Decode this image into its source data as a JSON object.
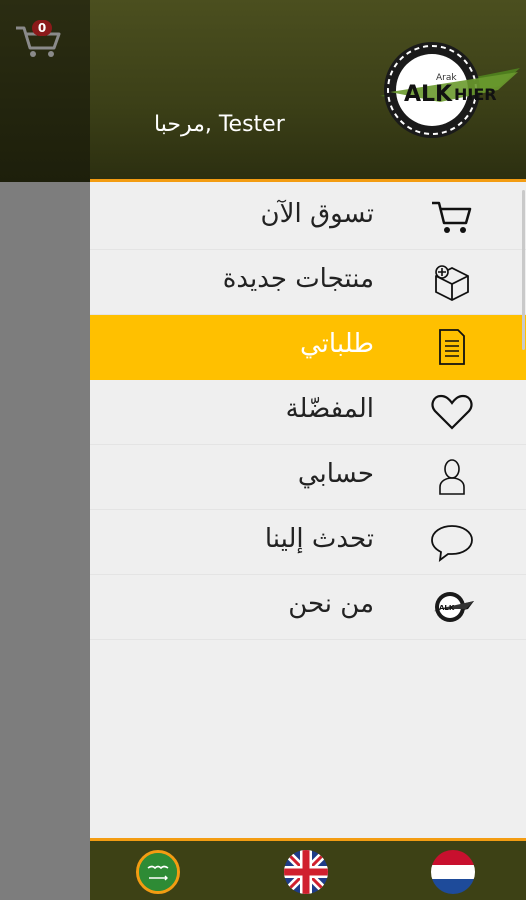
{
  "background": {
    "cart_count": "0",
    "accent_color": "#8b1a1a"
  },
  "drawer": {
    "welcome_text": "مرحبا, Tester",
    "logo_text": "ALKHIER",
    "logo_subtext": "Arak",
    "menu": [
      {
        "label": "تسوق الآن",
        "icon": "cart-icon"
      },
      {
        "label": "منتجات جديدة",
        "icon": "new-product-box-icon"
      },
      {
        "label": "طلباتي",
        "icon": "document-icon",
        "active": true
      },
      {
        "label": "المفضّلة",
        "icon": "heart-icon"
      },
      {
        "label": "حسابي",
        "icon": "user-icon"
      },
      {
        "label": "تحدث إلينا",
        "icon": "chat-bubble-icon"
      },
      {
        "label": "من نحن",
        "icon": "company-logo-icon"
      }
    ],
    "languages": [
      {
        "name": "Arabic",
        "icon": "saudi-flag-icon",
        "selected": true
      },
      {
        "name": "English",
        "icon": "uk-flag-icon"
      },
      {
        "name": "Dutch",
        "icon": "netherlands-flag-icon"
      }
    ],
    "colors": {
      "header": "#3b3f17",
      "active_item": "#ffc000",
      "separator": "#f39c12"
    }
  }
}
